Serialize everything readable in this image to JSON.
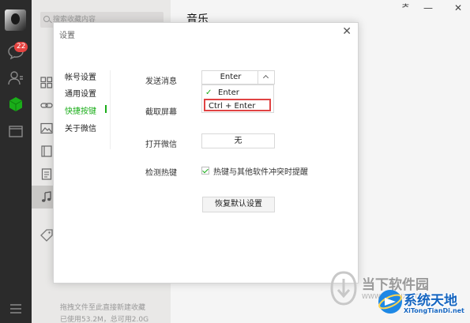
{
  "sidebar": {
    "badge": "22"
  },
  "list": {
    "search_placeholder": "搜索收藏内容",
    "footer_line1": "拖拽文件至此直接新建收藏",
    "footer_line2": "已使用53.2M，总可用2.0G"
  },
  "chat": {
    "title": "音乐",
    "pin_symbol": "ᅔ",
    "minimize_symbol": "—",
    "close_symbol": "✕"
  },
  "dialog": {
    "title": "设置",
    "close_symbol": "✕",
    "nav": [
      "帐号设置",
      "通用设置",
      "快捷按键",
      "关于微信"
    ],
    "send_message": {
      "label": "发送消息",
      "value": "Enter",
      "options": [
        "Enter",
        "Ctrl + Enter"
      ],
      "checked_option": "Enter",
      "highlighted_option": "Ctrl + Enter"
    },
    "screenshot_label": "截取屏幕",
    "open_wechat": {
      "label": "打开微信",
      "value": "无"
    },
    "detect_hotkey": {
      "label": "检测热键",
      "checkbox_label": "热键与其他软件冲突时提醒",
      "checked": true
    },
    "restore_button": "恢复默认设置"
  },
  "watermarks": {
    "site1_name": "当下软件园",
    "site1_url": "WWW.DOWNXIA.COM",
    "site2_name": "系统天地",
    "site2_url": "XiTongTianDi.net"
  },
  "colors": {
    "accent_green": "#1aad19",
    "badge_red": "#e64340",
    "highlight_red": "#e04343"
  }
}
